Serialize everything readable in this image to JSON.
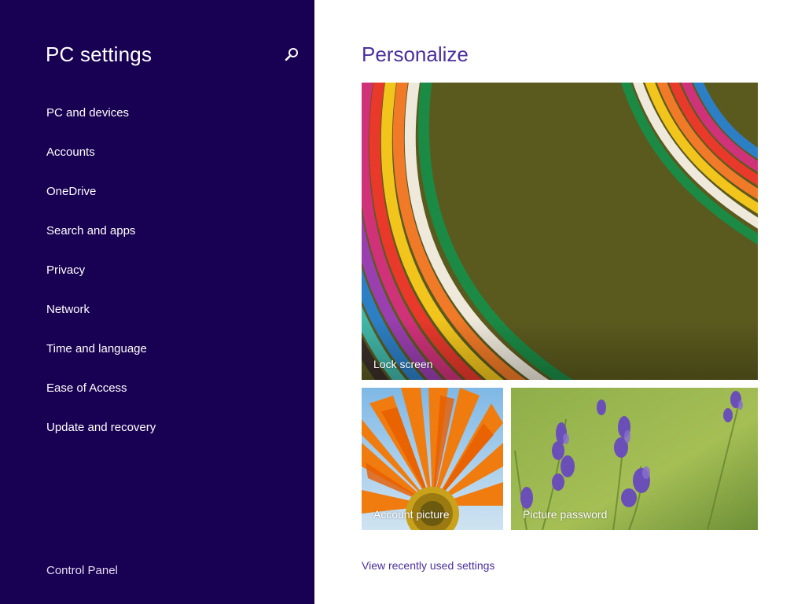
{
  "sidebar": {
    "title": "PC settings",
    "search_icon": "search-icon",
    "items": [
      {
        "label": "PC and devices"
      },
      {
        "label": "Accounts"
      },
      {
        "label": "OneDrive"
      },
      {
        "label": "Search and apps"
      },
      {
        "label": "Privacy"
      },
      {
        "label": "Network"
      },
      {
        "label": "Time and language"
      },
      {
        "label": "Ease of Access"
      },
      {
        "label": "Update and recovery"
      }
    ],
    "footer_link": "Control Panel"
  },
  "main": {
    "title": "Personalize",
    "tiles": [
      {
        "label": "Lock screen"
      },
      {
        "label": "Account picture"
      },
      {
        "label": "Picture password"
      }
    ],
    "view_link": "View recently used settings"
  },
  "colors": {
    "sidebar_bg": "#180052",
    "accent": "#4b2f9c",
    "main_bg": "#ffffff"
  }
}
